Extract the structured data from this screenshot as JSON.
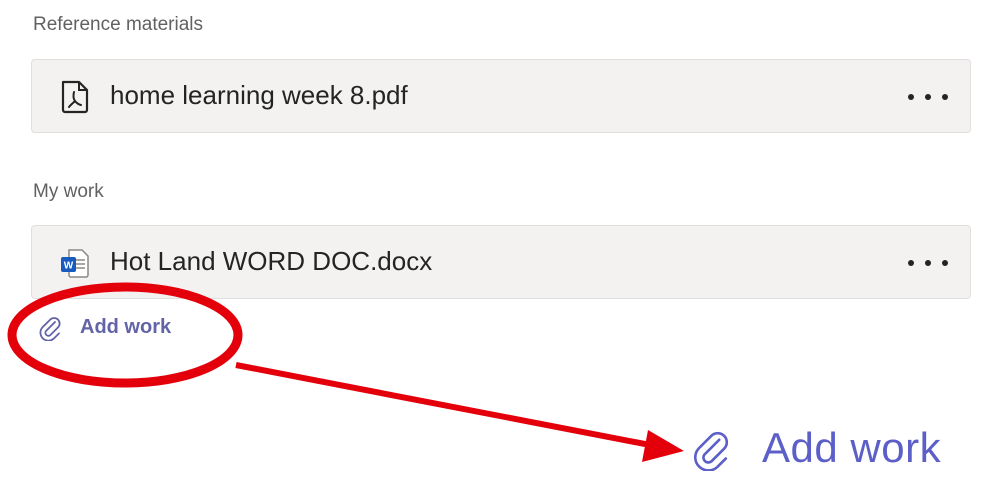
{
  "sections": {
    "reference_label": "Reference materials",
    "my_work_label": "My work"
  },
  "reference_files": [
    {
      "name": "home learning week 8.pdf",
      "icon": "pdf-file-icon"
    }
  ],
  "my_work_files": [
    {
      "name": "Hot Land WORD DOC.docx",
      "icon": "word-file-icon"
    }
  ],
  "actions": {
    "add_work_label": "Add work",
    "add_work_icon": "paperclip-icon",
    "more_options_icon": "ellipsis-icon"
  },
  "annotation": {
    "zoomed_add_work_label": "Add work",
    "highlight_color": "#e3000b",
    "callout": "circle-with-arrow"
  },
  "colors": {
    "accent": "#6264a7",
    "card_bg": "#f3f2f1",
    "label_gray": "#616161",
    "word_blue": "#185abd"
  }
}
